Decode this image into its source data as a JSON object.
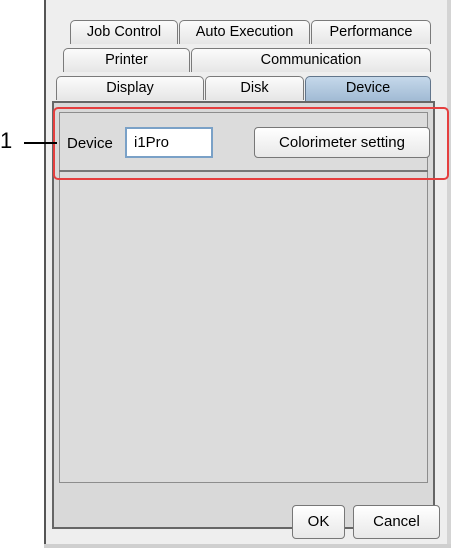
{
  "tabs_row1": [
    "Job Control",
    "Auto Execution",
    "Performance"
  ],
  "tabs_row2": [
    "Printer",
    "Communication"
  ],
  "tabs_row3": [
    "Display",
    "Disk",
    "Device"
  ],
  "selected_tab": "Device",
  "device": {
    "label": "Device",
    "value": "i1Pro",
    "colorimeter_button": "Colorimeter setting"
  },
  "footer": {
    "ok_label": "OK",
    "cancel_label": "Cancel"
  },
  "callout": {
    "number": "1"
  },
  "colors": {
    "selected_tab": "#b4cbe0",
    "highlight": "#e53f3f"
  }
}
